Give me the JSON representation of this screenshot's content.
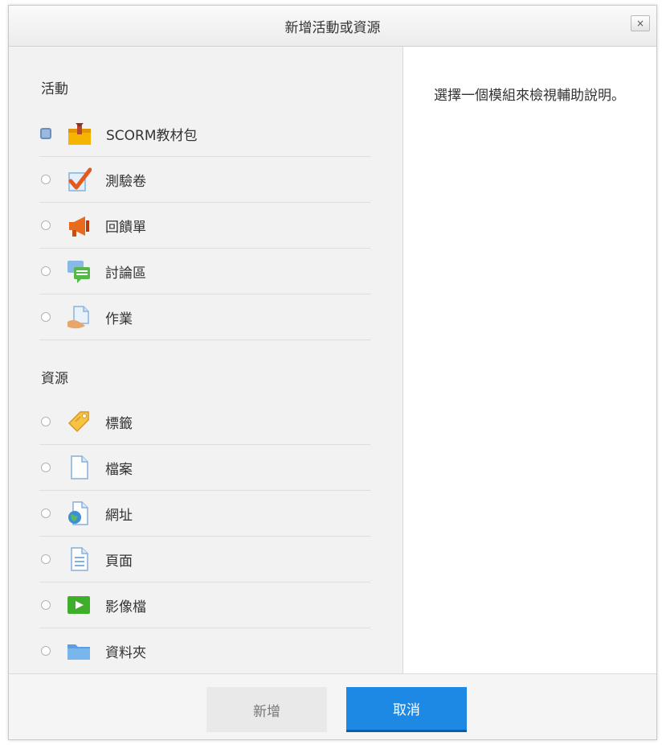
{
  "dialog": {
    "title": "新增活動或資源",
    "close_label": "×"
  },
  "activities": {
    "heading": "活動",
    "items": [
      {
        "label": "SCORM教材包",
        "icon": "scorm-package-icon",
        "selected": true
      },
      {
        "label": "測驗卷",
        "icon": "quiz-icon",
        "selected": false
      },
      {
        "label": "回饋單",
        "icon": "feedback-icon",
        "selected": false
      },
      {
        "label": "討論區",
        "icon": "forum-icon",
        "selected": false
      },
      {
        "label": "作業",
        "icon": "assignment-icon",
        "selected": false
      }
    ]
  },
  "resources": {
    "heading": "資源",
    "items": [
      {
        "label": "標籤",
        "icon": "label-icon",
        "selected": false
      },
      {
        "label": "檔案",
        "icon": "file-icon",
        "selected": false
      },
      {
        "label": "網址",
        "icon": "url-icon",
        "selected": false
      },
      {
        "label": "頁面",
        "icon": "page-icon",
        "selected": false
      },
      {
        "label": "影像檔",
        "icon": "video-icon",
        "selected": false
      },
      {
        "label": "資料夾",
        "icon": "folder-icon",
        "selected": false
      }
    ]
  },
  "help": {
    "text": "選擇一個模組來檢視輔助說明。"
  },
  "footer": {
    "add_label": "新增",
    "cancel_label": "取消"
  },
  "colors": {
    "primary_button": "#1e88e5",
    "options_background": "#f2f2f2"
  }
}
